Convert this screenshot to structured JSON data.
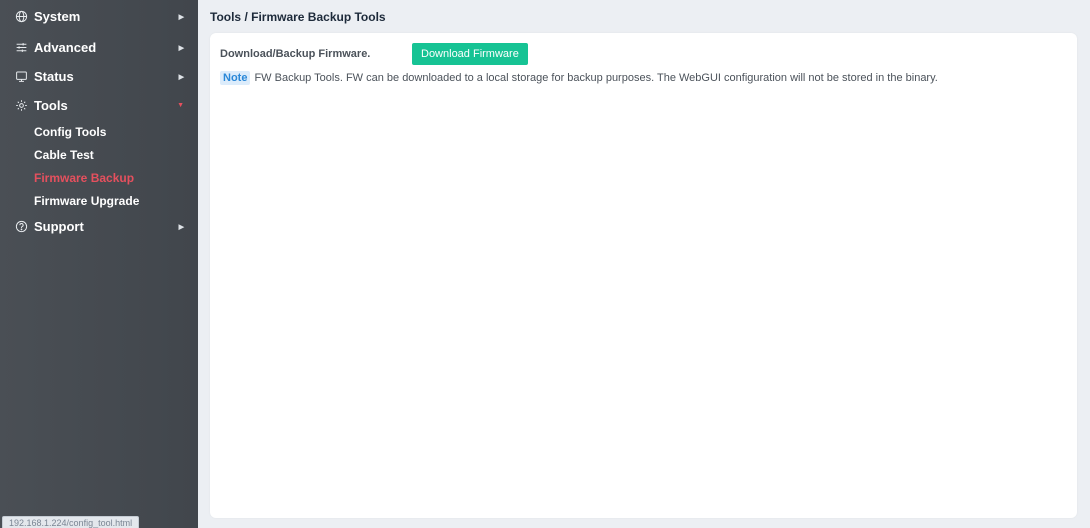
{
  "sidebar": {
    "items": [
      {
        "label": "System",
        "icon": "globe-icon"
      },
      {
        "label": "Advanced",
        "icon": "sliders-icon"
      },
      {
        "label": "Status",
        "icon": "monitor-icon"
      },
      {
        "label": "Tools",
        "icon": "gear-icon"
      },
      {
        "label": "Support",
        "icon": "help-icon"
      }
    ],
    "tools_sub": [
      {
        "label": "Config Tools"
      },
      {
        "label": "Cable Test"
      },
      {
        "label": "Firmware Backup"
      },
      {
        "label": "Firmware Upgrade"
      }
    ],
    "active_sub": "Firmware Backup",
    "caret_closed": "▶",
    "caret_open": "▼"
  },
  "statusbar": {
    "url": "192.168.1.224/config_tool.html"
  },
  "main": {
    "breadcrumb": "Tools / Firmware Backup Tools",
    "download_label": "Download/Backup Firmware.",
    "download_button": "Download Firmware",
    "note_tag": "Note",
    "note_text": "FW Backup Tools. FW can be downloaded to a local storage for backup purposes. The WebGUI configuration will not be stored in the binary."
  },
  "colors": {
    "sidebar_bg": "#454a50",
    "active": "#e5505e",
    "button": "#16c394",
    "note_bg": "#dcecfb",
    "note_fg": "#2a88d8"
  }
}
